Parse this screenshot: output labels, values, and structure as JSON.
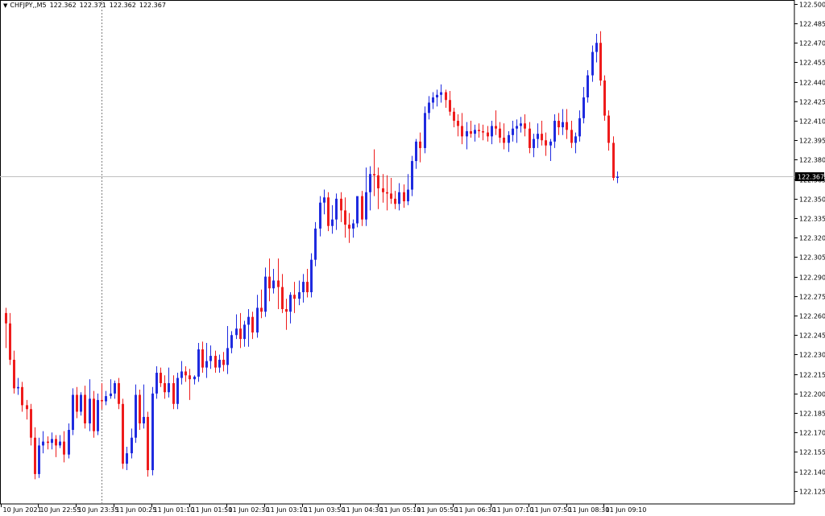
{
  "header": {
    "symbol": "CHFJPY,,M5",
    "ohlc": [
      "122.362",
      "122.371",
      "122.362",
      "122.367"
    ]
  },
  "colors": {
    "bull": "#1f2bdf",
    "bear": "#ee1c1c",
    "grid_frame": "#000000",
    "price_line": "#c0c0c0",
    "crosshair": "#7f7f7f"
  },
  "chart_data": {
    "type": "candlestick",
    "current_price": "122.367",
    "ylim": [
      122.115,
      122.503
    ],
    "y_ticks": [
      "122.500",
      "122.485",
      "122.470",
      "122.455",
      "122.440",
      "122.425",
      "122.410",
      "122.395",
      "122.380",
      "122.365",
      "122.350",
      "122.335",
      "122.320",
      "122.305",
      "122.290",
      "122.275",
      "122.260",
      "122.245",
      "122.230",
      "122.215",
      "122.200",
      "122.185",
      "122.170",
      "122.155",
      "122.140",
      "122.125"
    ],
    "x_ticks": [
      {
        "i": 0,
        "label": "10 Jun 2021"
      },
      {
        "i": 9,
        "label": "10 Jun 22:55"
      },
      {
        "i": 18,
        "label": "10 Jun 23:35"
      },
      {
        "i": 27,
        "label": "11 Jun 00:25"
      },
      {
        "i": 36,
        "label": "11 Jun 01:10"
      },
      {
        "i": 45,
        "label": "11 Jun 01:50"
      },
      {
        "i": 54,
        "label": "11 Jun 02:30"
      },
      {
        "i": 63,
        "label": "11 Jun 03:10"
      },
      {
        "i": 72,
        "label": "11 Jun 03:50"
      },
      {
        "i": 81,
        "label": "11 Jun 04:30"
      },
      {
        "i": 90,
        "label": "11 Jun 05:10"
      },
      {
        "i": 99,
        "label": "11 Jun 05:50"
      },
      {
        "i": 108,
        "label": "11 Jun 06:30"
      },
      {
        "i": 117,
        "label": "11 Jun 07:10"
      },
      {
        "i": 126,
        "label": "11 Jun 07:50"
      },
      {
        "i": 135,
        "label": "11 Jun 08:30"
      },
      {
        "i": 144,
        "label": "11 Jun 09:10"
      }
    ],
    "crosshair_index": 23,
    "candles": [
      [
        122.262,
        122.266,
        122.235,
        122.254
      ],
      [
        122.254,
        122.262,
        122.222,
        122.226
      ],
      [
        122.226,
        122.233,
        122.2,
        122.204
      ],
      [
        122.204,
        122.212,
        122.199,
        122.205
      ],
      [
        122.205,
        122.209,
        122.186,
        122.191
      ],
      [
        122.191,
        122.195,
        122.18,
        122.188
      ],
      [
        122.188,
        122.192,
        122.16,
        122.166
      ],
      [
        122.166,
        122.174,
        122.134,
        122.138
      ],
      [
        122.138,
        122.166,
        122.135,
        122.16
      ],
      [
        122.16,
        122.171,
        122.154,
        122.163
      ],
      [
        122.163,
        122.167,
        122.157,
        122.162
      ],
      [
        122.162,
        122.17,
        122.157,
        122.165
      ],
      [
        122.165,
        122.168,
        122.151,
        122.16
      ],
      [
        122.16,
        122.168,
        122.158,
        122.163
      ],
      [
        122.163,
        122.171,
        122.147,
        122.153
      ],
      [
        122.153,
        122.177,
        122.15,
        122.172
      ],
      [
        122.172,
        122.204,
        122.168,
        122.199
      ],
      [
        122.199,
        122.205,
        122.181,
        122.186
      ],
      [
        122.186,
        122.201,
        122.183,
        122.199
      ],
      [
        122.199,
        122.206,
        122.173,
        122.177
      ],
      [
        122.177,
        122.211,
        122.171,
        122.196
      ],
      [
        122.196,
        122.202,
        122.166,
        122.171
      ],
      [
        122.171,
        122.2,
        122.168,
        122.195
      ],
      [
        122.195,
        122.208,
        122.188,
        122.194
      ],
      [
        122.194,
        122.202,
        122.191,
        122.198
      ],
      [
        122.198,
        122.211,
        122.196,
        122.2
      ],
      [
        122.2,
        122.21,
        122.196,
        122.208
      ],
      [
        122.208,
        122.212,
        122.188,
        122.192
      ],
      [
        122.192,
        122.196,
        122.142,
        122.146
      ],
      [
        122.146,
        122.159,
        122.141,
        122.154
      ],
      [
        122.154,
        122.173,
        122.15,
        122.166
      ],
      [
        122.166,
        122.207,
        122.162,
        122.199
      ],
      [
        122.199,
        122.203,
        122.172,
        122.177
      ],
      [
        122.177,
        122.207,
        122.173,
        122.182
      ],
      [
        122.182,
        122.186,
        122.136,
        122.141
      ],
      [
        122.141,
        122.205,
        122.137,
        122.2
      ],
      [
        122.2,
        122.221,
        122.196,
        122.216
      ],
      [
        122.216,
        122.22,
        122.205,
        122.208
      ],
      [
        122.208,
        122.214,
        122.196,
        122.201
      ],
      [
        122.201,
        122.22,
        122.197,
        122.208
      ],
      [
        122.208,
        122.214,
        122.188,
        122.192
      ],
      [
        122.192,
        122.216,
        122.188,
        122.212
      ],
      [
        122.212,
        122.225,
        122.207,
        122.217
      ],
      [
        122.217,
        122.221,
        122.209,
        122.214
      ],
      [
        122.214,
        122.219,
        122.195,
        122.211
      ],
      [
        122.211,
        122.214,
        122.207,
        122.213
      ],
      [
        122.213,
        122.239,
        122.209,
        122.234
      ],
      [
        122.234,
        122.24,
        122.216,
        122.22
      ],
      [
        122.22,
        122.239,
        122.212,
        122.225
      ],
      [
        122.225,
        122.237,
        122.219,
        122.229
      ],
      [
        122.229,
        122.233,
        122.216,
        122.22
      ],
      [
        122.22,
        122.23,
        122.216,
        122.226
      ],
      [
        122.226,
        122.232,
        122.217,
        122.222
      ],
      [
        122.222,
        122.252,
        122.215,
        122.235
      ],
      [
        122.235,
        122.248,
        122.231,
        122.245
      ],
      [
        122.245,
        122.261,
        122.242,
        122.25
      ],
      [
        122.25,
        122.262,
        122.235,
        122.242
      ],
      [
        122.242,
        122.256,
        122.236,
        122.253
      ],
      [
        122.253,
        122.265,
        122.236,
        122.259
      ],
      [
        122.259,
        122.263,
        122.242,
        122.247
      ],
      [
        122.247,
        122.276,
        122.243,
        122.266
      ],
      [
        122.266,
        122.28,
        122.258,
        122.263
      ],
      [
        122.263,
        122.297,
        122.259,
        122.29
      ],
      [
        122.29,
        122.304,
        122.271,
        122.281
      ],
      [
        122.281,
        122.296,
        122.277,
        122.287
      ],
      [
        122.287,
        122.304,
        122.265,
        122.282
      ],
      [
        122.282,
        122.292,
        122.262,
        122.265
      ],
      [
        122.265,
        122.273,
        122.249,
        122.263
      ],
      [
        122.263,
        122.278,
        122.254,
        122.276
      ],
      [
        122.276,
        122.286,
        122.262,
        122.273
      ],
      [
        122.273,
        122.287,
        122.268,
        122.278
      ],
      [
        122.278,
        122.292,
        122.27,
        122.286
      ],
      [
        122.286,
        122.296,
        122.274,
        122.278
      ],
      [
        122.278,
        122.308,
        122.274,
        122.303
      ],
      [
        122.303,
        122.332,
        122.298,
        122.327
      ],
      [
        122.327,
        122.352,
        122.321,
        122.347
      ],
      [
        122.347,
        122.357,
        122.338,
        122.351
      ],
      [
        122.351,
        122.355,
        122.325,
        122.329
      ],
      [
        122.329,
        122.345,
        122.323,
        122.334
      ],
      [
        122.334,
        122.354,
        122.326,
        122.35
      ],
      [
        122.35,
        122.355,
        122.332,
        122.341
      ],
      [
        122.341,
        122.351,
        122.32,
        122.33
      ],
      [
        122.33,
        122.339,
        122.316,
        122.327
      ],
      [
        122.327,
        122.334,
        122.32,
        122.331
      ],
      [
        122.331,
        122.351,
        122.328,
        122.352
      ],
      [
        122.352,
        122.356,
        122.329,
        122.334
      ],
      [
        122.334,
        122.374,
        122.329,
        122.355
      ],
      [
        122.355,
        122.375,
        122.341,
        122.369
      ],
      [
        122.369,
        122.388,
        122.352,
        122.368
      ],
      [
        122.368,
        122.374,
        122.342,
        122.358
      ],
      [
        122.358,
        122.369,
        122.347,
        122.355
      ],
      [
        122.355,
        122.368,
        122.341,
        122.354
      ],
      [
        122.354,
        122.366,
        122.346,
        122.35
      ],
      [
        122.35,
        122.356,
        122.342,
        122.346
      ],
      [
        122.346,
        122.362,
        122.341,
        122.355
      ],
      [
        122.355,
        122.361,
        122.343,
        122.348
      ],
      [
        122.348,
        122.369,
        122.345,
        122.357
      ],
      [
        122.357,
        122.383,
        122.352,
        122.379
      ],
      [
        122.379,
        122.396,
        122.373,
        122.394
      ],
      [
        122.394,
        122.401,
        122.378,
        122.389
      ],
      [
        122.389,
        122.421,
        122.385,
        122.416
      ],
      [
        122.416,
        122.429,
        122.411,
        122.424
      ],
      [
        122.424,
        122.432,
        122.419,
        122.428
      ],
      [
        122.428,
        122.434,
        122.421,
        122.43
      ],
      [
        122.43,
        122.438,
        122.424,
        122.432
      ],
      [
        122.432,
        122.434,
        122.42,
        122.426
      ],
      [
        122.426,
        122.433,
        122.414,
        122.417
      ],
      [
        122.417,
        122.42,
        122.405,
        122.41
      ],
      [
        122.41,
        122.415,
        122.398,
        122.406
      ],
      [
        122.406,
        122.416,
        122.392,
        122.398
      ],
      [
        122.398,
        122.409,
        122.388,
        122.402
      ],
      [
        122.402,
        122.41,
        122.397,
        122.4
      ],
      [
        122.4,
        122.407,
        122.394,
        122.403
      ],
      [
        122.403,
        122.408,
        122.397,
        122.402
      ],
      [
        122.402,
        122.407,
        122.395,
        122.401
      ],
      [
        122.401,
        122.406,
        122.394,
        122.398
      ],
      [
        122.398,
        122.41,
        122.392,
        122.406
      ],
      [
        122.406,
        122.418,
        122.399,
        122.404
      ],
      [
        122.404,
        122.409,
        122.393,
        122.397
      ],
      [
        122.397,
        122.408,
        122.388,
        122.393
      ],
      [
        122.393,
        122.402,
        122.386,
        122.399
      ],
      [
        122.399,
        122.41,
        122.394,
        122.404
      ],
      [
        122.404,
        122.411,
        122.393,
        122.406
      ],
      [
        122.406,
        122.413,
        122.401,
        122.408
      ],
      [
        122.408,
        122.415,
        122.398,
        122.404
      ],
      [
        122.404,
        122.409,
        122.385,
        122.389
      ],
      [
        122.389,
        122.4,
        122.382,
        122.396
      ],
      [
        122.396,
        122.408,
        122.389,
        122.4
      ],
      [
        122.4,
        122.41,
        122.391,
        122.395
      ],
      [
        122.395,
        122.401,
        122.383,
        122.391
      ],
      [
        122.391,
        122.396,
        122.379,
        122.394
      ],
      [
        122.394,
        122.415,
        122.389,
        122.41
      ],
      [
        122.41,
        122.416,
        122.399,
        122.405
      ],
      [
        122.405,
        122.419,
        122.399,
        122.409
      ],
      [
        122.409,
        122.419,
        122.396,
        122.403
      ],
      [
        122.403,
        122.41,
        122.389,
        122.393
      ],
      [
        122.393,
        122.401,
        122.385,
        122.398
      ],
      [
        122.398,
        122.418,
        122.394,
        122.412
      ],
      [
        122.412,
        122.436,
        122.408,
        122.428
      ],
      [
        122.428,
        122.449,
        122.424,
        122.445
      ],
      [
        122.445,
        122.468,
        122.44,
        122.463
      ],
      [
        122.463,
        122.477,
        122.455,
        122.47
      ],
      [
        122.47,
        122.479,
        122.437,
        122.441
      ],
      [
        122.441,
        122.445,
        122.41,
        122.414
      ],
      [
        122.414,
        122.418,
        122.387,
        122.393
      ],
      [
        122.393,
        122.398,
        122.364,
        122.366
      ],
      [
        122.366,
        122.371,
        122.362,
        122.367
      ]
    ]
  }
}
